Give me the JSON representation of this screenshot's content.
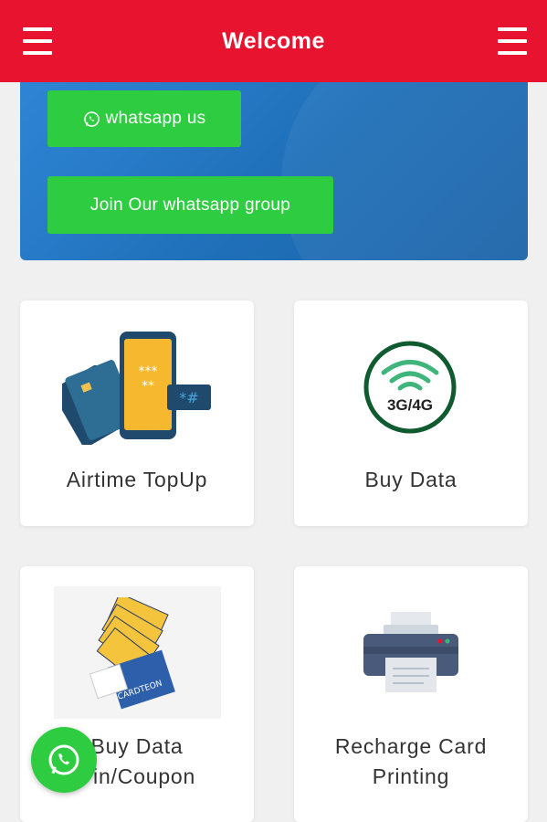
{
  "header": {
    "title": "Welcome",
    "left_icon": "menu-icon",
    "right_icon": "menu-icon",
    "color": "#e8132f"
  },
  "banner": {
    "whatsapp_button": "whatsapp us",
    "group_button": "Join Our whatsapp group",
    "button_color": "#2ecc40"
  },
  "services": [
    {
      "label": "Airtime TopUp",
      "icon": "phone-cards-icon"
    },
    {
      "label": "Buy Data",
      "icon": "wifi-3g4g-icon",
      "icon_text": "3G/4G"
    },
    {
      "label_line1": "Buy Data",
      "label_line2": "Pin/Coupon",
      "icon": "scratch-cards-icon",
      "icon_text": "CARDTEON"
    },
    {
      "label_line1": "Recharge Card",
      "label_line2": "Printing",
      "icon": "printer-icon"
    }
  ],
  "fab": {
    "icon": "whatsapp-icon"
  }
}
